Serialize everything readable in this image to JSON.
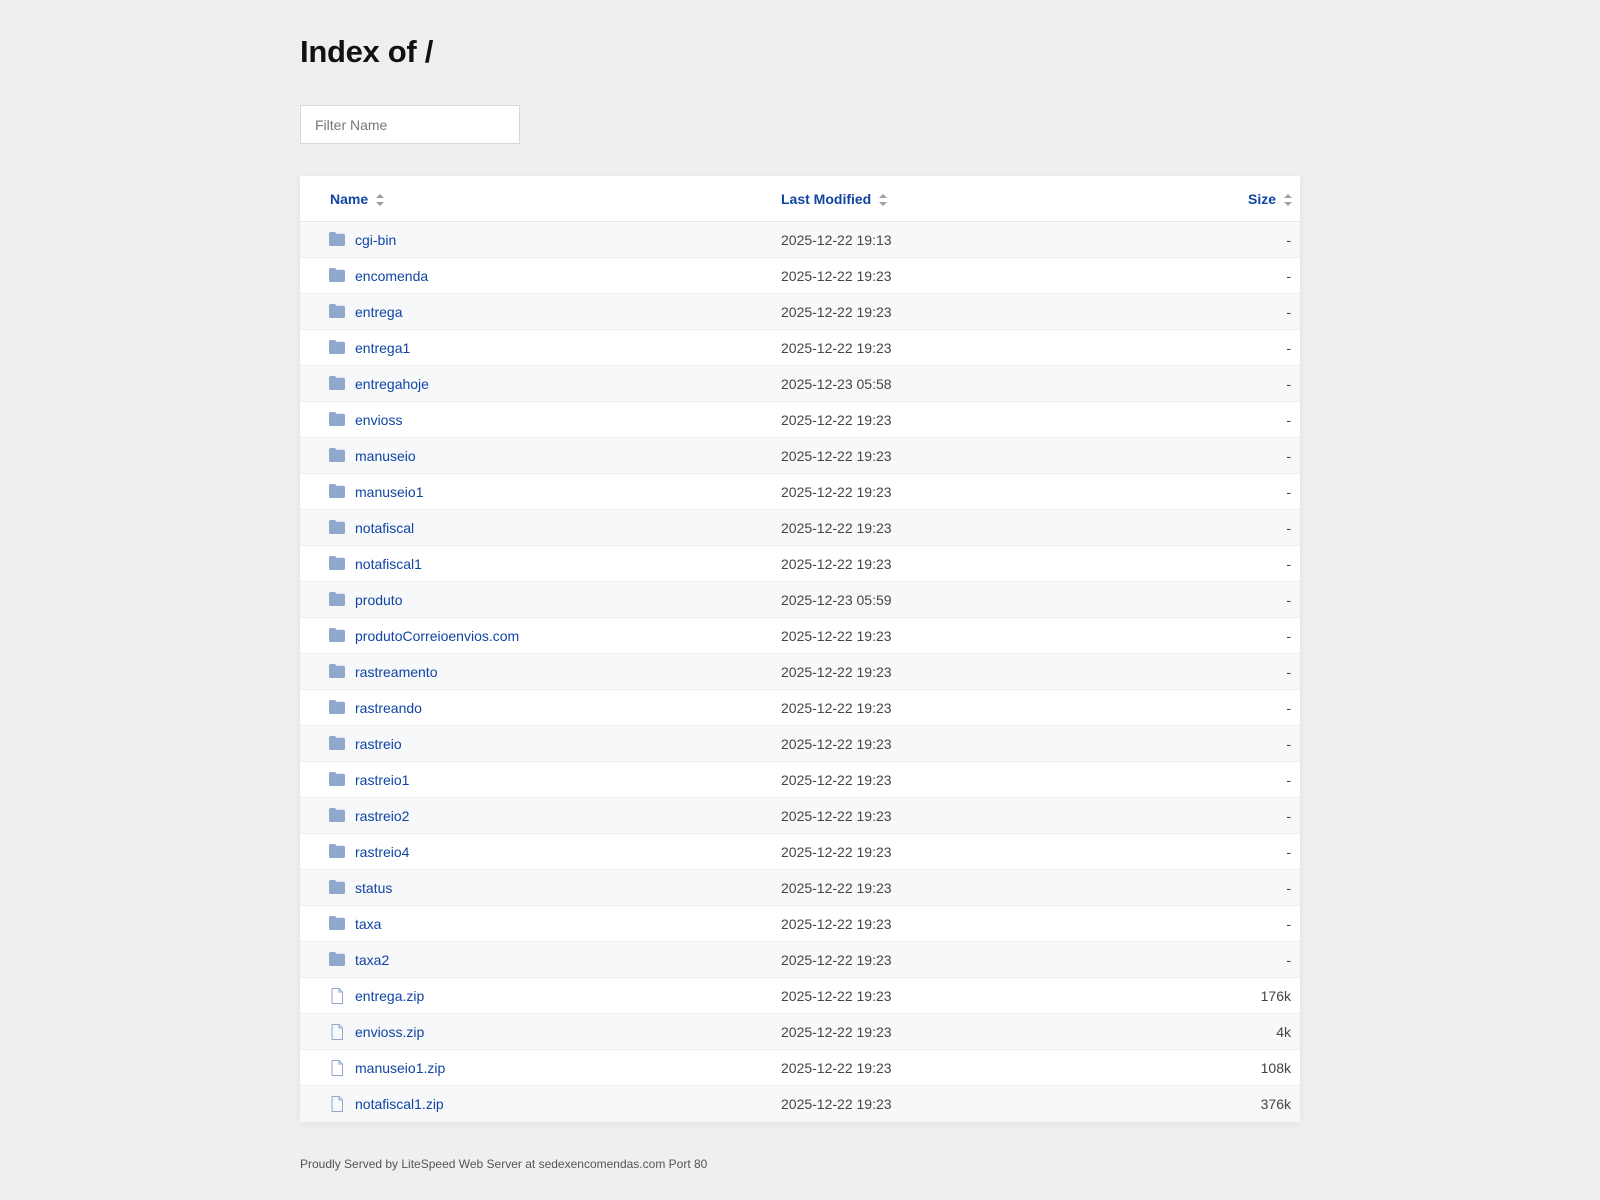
{
  "page": {
    "title": "Index of /",
    "filter_placeholder": "Filter Name",
    "footer": "Proudly Served by LiteSpeed Web Server at sedexencomendas.com Port 80"
  },
  "colors": {
    "link": "#1144a3",
    "folder_icon": "#8fa8cc",
    "background": "#eeeff1"
  },
  "table": {
    "headers": {
      "name": "Name",
      "modified": "Last Modified",
      "size": "Size"
    },
    "rows": [
      {
        "type": "folder",
        "icon": "folder-icon",
        "name": "cgi-bin",
        "modified": "2025-12-22 19:13",
        "size": "-"
      },
      {
        "type": "folder",
        "icon": "folder-icon",
        "name": "encomenda",
        "modified": "2025-12-22 19:23",
        "size": "-"
      },
      {
        "type": "folder",
        "icon": "folder-icon",
        "name": "entrega",
        "modified": "2025-12-22 19:23",
        "size": "-"
      },
      {
        "type": "folder",
        "icon": "folder-icon",
        "name": "entrega1",
        "modified": "2025-12-22 19:23",
        "size": "-"
      },
      {
        "type": "folder",
        "icon": "folder-icon",
        "name": "entregahoje",
        "modified": "2025-12-23 05:58",
        "size": "-"
      },
      {
        "type": "folder",
        "icon": "folder-icon",
        "name": "envioss",
        "modified": "2025-12-22 19:23",
        "size": "-"
      },
      {
        "type": "folder",
        "icon": "folder-icon",
        "name": "manuseio",
        "modified": "2025-12-22 19:23",
        "size": "-"
      },
      {
        "type": "folder",
        "icon": "folder-icon",
        "name": "manuseio1",
        "modified": "2025-12-22 19:23",
        "size": "-"
      },
      {
        "type": "folder",
        "icon": "folder-icon",
        "name": "notafiscal",
        "modified": "2025-12-22 19:23",
        "size": "-"
      },
      {
        "type": "folder",
        "icon": "folder-icon",
        "name": "notafiscal1",
        "modified": "2025-12-22 19:23",
        "size": "-"
      },
      {
        "type": "folder",
        "icon": "folder-icon",
        "name": "produto",
        "modified": "2025-12-23 05:59",
        "size": "-"
      },
      {
        "type": "folder",
        "icon": "folder-icon",
        "name": "produtoCorreioenvios.com",
        "modified": "2025-12-22 19:23",
        "size": "-"
      },
      {
        "type": "folder",
        "icon": "folder-icon",
        "name": "rastreamento",
        "modified": "2025-12-22 19:23",
        "size": "-"
      },
      {
        "type": "folder",
        "icon": "folder-icon",
        "name": "rastreando",
        "modified": "2025-12-22 19:23",
        "size": "-"
      },
      {
        "type": "folder",
        "icon": "folder-icon",
        "name": "rastreio",
        "modified": "2025-12-22 19:23",
        "size": "-"
      },
      {
        "type": "folder",
        "icon": "folder-icon",
        "name": "rastreio1",
        "modified": "2025-12-22 19:23",
        "size": "-"
      },
      {
        "type": "folder",
        "icon": "folder-icon",
        "name": "rastreio2",
        "modified": "2025-12-22 19:23",
        "size": "-"
      },
      {
        "type": "folder",
        "icon": "folder-icon",
        "name": "rastreio4",
        "modified": "2025-12-22 19:23",
        "size": "-"
      },
      {
        "type": "folder",
        "icon": "folder-icon",
        "name": "status",
        "modified": "2025-12-22 19:23",
        "size": "-"
      },
      {
        "type": "folder",
        "icon": "folder-icon",
        "name": "taxa",
        "modified": "2025-12-22 19:23",
        "size": "-"
      },
      {
        "type": "folder",
        "icon": "folder-icon",
        "name": "taxa2",
        "modified": "2025-12-22 19:23",
        "size": "-"
      },
      {
        "type": "file",
        "icon": "file-icon",
        "name": "entrega.zip",
        "modified": "2025-12-22 19:23",
        "size": "176k"
      },
      {
        "type": "file",
        "icon": "file-icon",
        "name": "envioss.zip",
        "modified": "2025-12-22 19:23",
        "size": "4k"
      },
      {
        "type": "file",
        "icon": "file-icon",
        "name": "manuseio1.zip",
        "modified": "2025-12-22 19:23",
        "size": "108k"
      },
      {
        "type": "file",
        "icon": "file-icon",
        "name": "notafiscal1.zip",
        "modified": "2025-12-22 19:23",
        "size": "376k"
      }
    ]
  }
}
